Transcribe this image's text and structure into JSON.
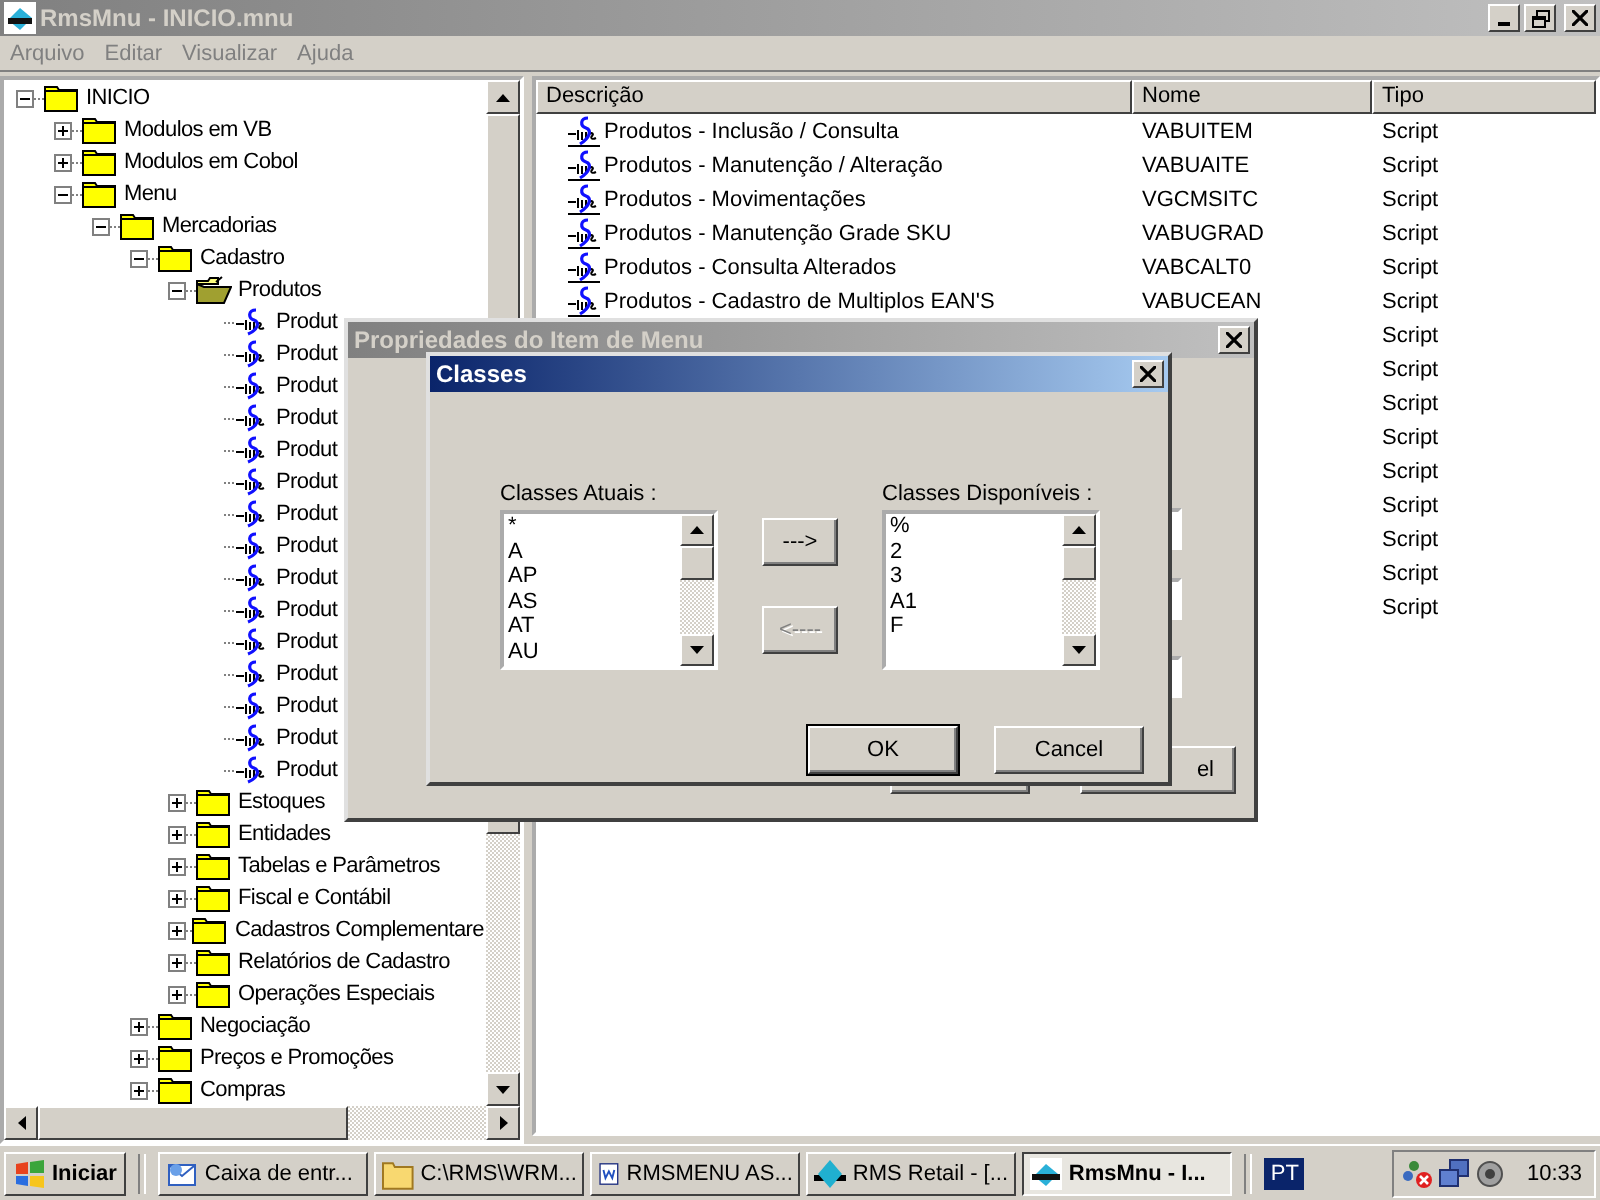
{
  "window": {
    "title": "RmsMnu - INICIO.mnu",
    "active": false
  },
  "menu": [
    {
      "label": "Arquivo",
      "disabled": true
    },
    {
      "label": "Editar",
      "disabled": true
    },
    {
      "label": "Visualizar",
      "disabled": true
    },
    {
      "label": "Ajuda",
      "disabled": true
    }
  ],
  "tree": [
    {
      "label": "INICIO",
      "kind": "folder",
      "expanded": true,
      "selected": false,
      "children": [
        {
          "label": "Modulos em VB",
          "kind": "folder",
          "expanded": false,
          "selected": false
        },
        {
          "label": "Modulos em Cobol",
          "kind": "folder",
          "expanded": false,
          "selected": false
        },
        {
          "label": "Menu",
          "kind": "folder",
          "expanded": true,
          "selected": false,
          "children": [
            {
              "label": "Mercadorias",
              "kind": "folder",
              "expanded": true,
              "selected": false,
              "children": [
                {
                  "label": "Cadastro",
                  "kind": "folder",
                  "expanded": true,
                  "selected": false,
                  "children": [
                    {
                      "label": "Produtos",
                      "kind": "folder",
                      "expanded": true,
                      "selected": true,
                      "children": [
                        {
                          "label": "Produt",
                          "kind": "script"
                        },
                        {
                          "label": "Produt",
                          "kind": "script"
                        },
                        {
                          "label": "Produt",
                          "kind": "script"
                        },
                        {
                          "label": "Produt",
                          "kind": "script"
                        },
                        {
                          "label": "Produt",
                          "kind": "script"
                        },
                        {
                          "label": "Produt",
                          "kind": "script"
                        },
                        {
                          "label": "Produt",
                          "kind": "script"
                        },
                        {
                          "label": "Produt",
                          "kind": "script"
                        },
                        {
                          "label": "Produt",
                          "kind": "script"
                        },
                        {
                          "label": "Produt",
                          "kind": "script"
                        },
                        {
                          "label": "Produt",
                          "kind": "script"
                        },
                        {
                          "label": "Produt",
                          "kind": "script"
                        },
                        {
                          "label": "Produt",
                          "kind": "script"
                        },
                        {
                          "label": "Produt",
                          "kind": "script"
                        },
                        {
                          "label": "Produt",
                          "kind": "script"
                        }
                      ]
                    },
                    {
                      "label": "Estoques",
                      "kind": "folder",
                      "expanded": false,
                      "selected": false
                    },
                    {
                      "label": "Entidades",
                      "kind": "folder",
                      "expanded": false,
                      "selected": false
                    },
                    {
                      "label": "Tabelas e Parâmetros",
                      "kind": "folder",
                      "expanded": false,
                      "selected": false
                    },
                    {
                      "label": "Fiscal e Contábil",
                      "kind": "folder",
                      "expanded": false,
                      "selected": false
                    },
                    {
                      "label": "Cadastros Complementare",
                      "kind": "folder",
                      "expanded": false,
                      "selected": false
                    },
                    {
                      "label": "Relatórios de Cadastro",
                      "kind": "folder",
                      "expanded": false,
                      "selected": false
                    },
                    {
                      "label": "Operações Especiais",
                      "kind": "folder",
                      "expanded": false,
                      "selected": false
                    }
                  ]
                },
                {
                  "label": "Negociação",
                  "kind": "folder",
                  "expanded": false,
                  "selected": false
                },
                {
                  "label": "Preços e Promoções",
                  "kind": "folder",
                  "expanded": false,
                  "selected": false
                },
                {
                  "label": "Compras",
                  "kind": "folder",
                  "expanded": false,
                  "selected": false
                }
              ]
            }
          ]
        }
      ]
    }
  ],
  "list": {
    "columns": [
      "Descrição",
      "Nome",
      "Tipo"
    ],
    "rows": [
      {
        "descricao": "Produtos - Inclusão / Consulta",
        "nome": "VABUITEM",
        "tipo": "Script"
      },
      {
        "descricao": "Produtos - Manutenção / Alteração",
        "nome": "VABUAITE",
        "tipo": "Script"
      },
      {
        "descricao": "Produtos - Movimentações",
        "nome": "VGCMSITC",
        "tipo": "Script"
      },
      {
        "descricao": "Produtos - Manutenção Grade SKU",
        "nome": "VABUGRAD",
        "tipo": "Script"
      },
      {
        "descricao": "Produtos - Consulta Alterados",
        "nome": "VABCALT0",
        "tipo": "Script"
      },
      {
        "descricao": "Produtos - Cadastro de Multiplos EAN'S",
        "nome": "VABUCEAN",
        "tipo": "Script"
      },
      {
        "tipo": "Script"
      },
      {
        "tipo": "Script"
      },
      {
        "tipo": "Script"
      },
      {
        "tipo": "Script"
      },
      {
        "tipo": "Script"
      },
      {
        "tipo": "Script"
      },
      {
        "tipo": "Script"
      },
      {
        "tipo": "Script"
      },
      {
        "tipo": "Script"
      }
    ]
  },
  "properties_dialog": {
    "title": "Propriedades do Item de Menu",
    "active": false,
    "cancel_button": "el"
  },
  "classes_dialog": {
    "title": "Classes",
    "active": true,
    "lists": [
      {
        "label": "Classes Atuais :",
        "items": [
          "*",
          "A",
          "AP",
          "AS",
          "AT",
          "AU"
        ]
      },
      {
        "label": "Classes Disponíveis :",
        "items": [
          "%",
          "2",
          "3",
          "A1",
          "F"
        ]
      }
    ],
    "move_buttons": [
      {
        "label": "--->",
        "disabled": false
      },
      {
        "label": "<----",
        "disabled": true
      }
    ],
    "buttons": [
      {
        "label": "OK",
        "default": true
      },
      {
        "label": "Cancel",
        "default": false
      }
    ]
  },
  "taskbar": {
    "start": "Iniciar",
    "tasks": [
      {
        "label": "Caixa de entr...",
        "kind": "mail",
        "selected": false
      },
      {
        "label": "C:\\RMS\\WRM...",
        "kind": "folder",
        "selected": false
      },
      {
        "label": "RMSMENU AS...",
        "kind": "word",
        "selected": false
      },
      {
        "label": "RMS Retail - [...",
        "kind": "retail",
        "selected": false
      },
      {
        "label": "RmsMnu - I...",
        "kind": "rms",
        "selected": true
      }
    ],
    "language": "PT",
    "clock": "10:33"
  }
}
